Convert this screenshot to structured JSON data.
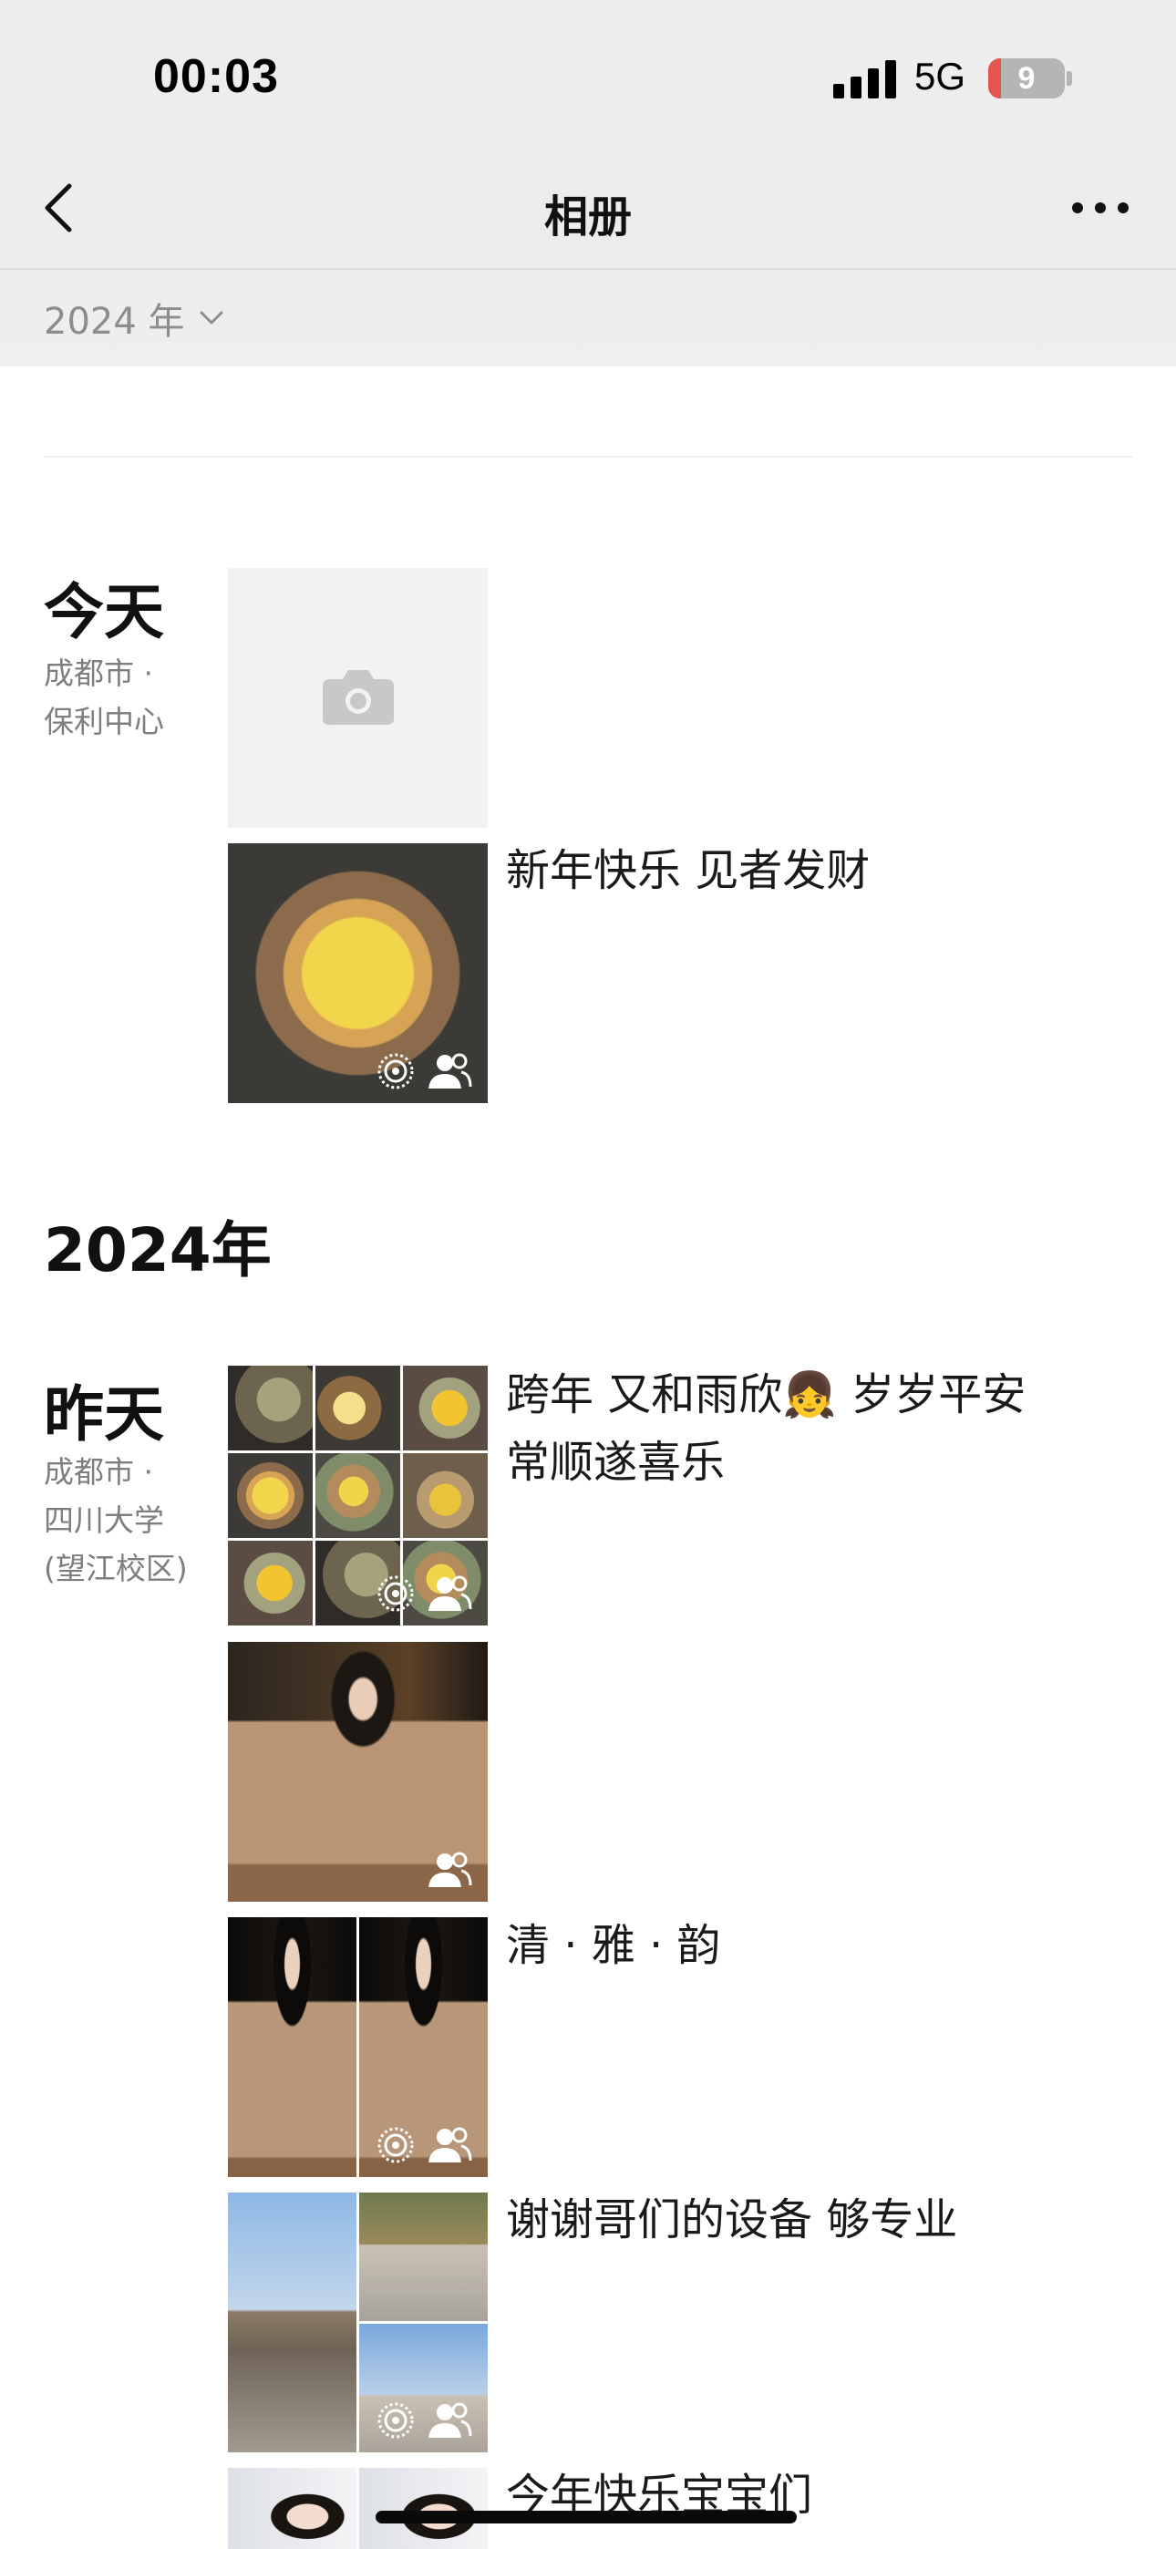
{
  "status_bar": {
    "time": "00:03",
    "network": "5G",
    "battery": "9",
    "battery_fraction": 0.09
  },
  "nav": {
    "title": "相册",
    "year_filter": "2024 年"
  },
  "colors": {
    "header_bg": "#eeeeee",
    "secondary_text": "#7e7e7e",
    "battery_low": "#e5554d"
  },
  "today": {
    "label": "今天",
    "location_line1": "成都市 ·",
    "location_line2": "保利中心",
    "posts": [
      {
        "caption": "",
        "icons": [
          "camera-icon"
        ]
      },
      {
        "caption": "新年快乐 见者发财",
        "icons": [
          "live-photo-icon",
          "visible-to-icon"
        ]
      }
    ]
  },
  "year_heading": "2024年",
  "yesterday": {
    "label": "昨天",
    "location_line1": "成都市 ·",
    "location_line2": "四川大学",
    "location_line3": "(望江校区)",
    "posts": [
      {
        "caption": "跨年 又和雨欣👧 岁岁平安",
        "caption2": "常顺遂喜乐",
        "photo_count": 9,
        "icons": [
          "live-photo-icon",
          "visible-to-icon"
        ]
      },
      {
        "caption": "",
        "photo_count": 1,
        "icons": [
          "visible-to-icon"
        ]
      },
      {
        "caption": "清 · 雅 · 韵",
        "photo_count": 2,
        "icons": [
          "live-photo-icon",
          "visible-to-icon"
        ]
      },
      {
        "caption": "谢谢哥们的设备 够专业",
        "photo_count": 3,
        "icons": [
          "live-photo-icon",
          "visible-to-icon"
        ]
      },
      {
        "caption": "今年快乐宝宝们",
        "photo_count": 2
      }
    ]
  }
}
